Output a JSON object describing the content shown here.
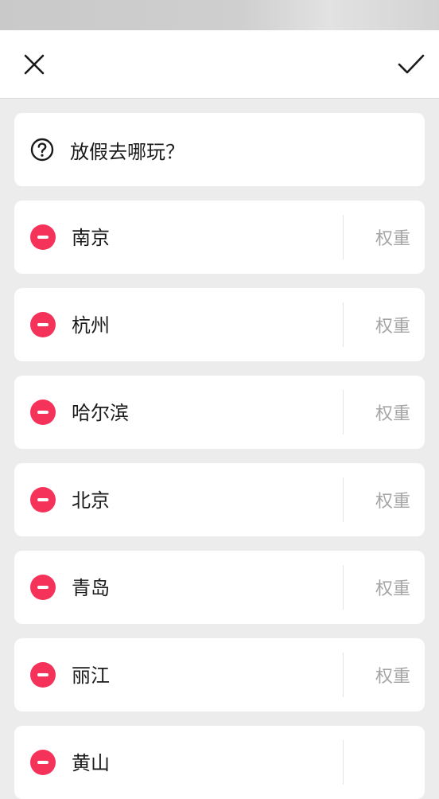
{
  "toolbar": {
    "close_icon": "close-icon",
    "confirm_icon": "checkmark-icon"
  },
  "question": {
    "icon": "question-circle-icon",
    "text": "放假去哪玩？"
  },
  "options": [
    {
      "name": "南京",
      "weight_placeholder": "权重"
    },
    {
      "name": "杭州",
      "weight_placeholder": "权重"
    },
    {
      "name": "哈尔滨",
      "weight_placeholder": "权重"
    },
    {
      "name": "北京",
      "weight_placeholder": "权重"
    },
    {
      "name": "青岛",
      "weight_placeholder": "权重"
    },
    {
      "name": "丽江",
      "weight_placeholder": "权重"
    },
    {
      "name": "黄山",
      "weight_placeholder": ""
    }
  ],
  "colors": {
    "remove": "#f5325a",
    "background": "#ececec"
  }
}
